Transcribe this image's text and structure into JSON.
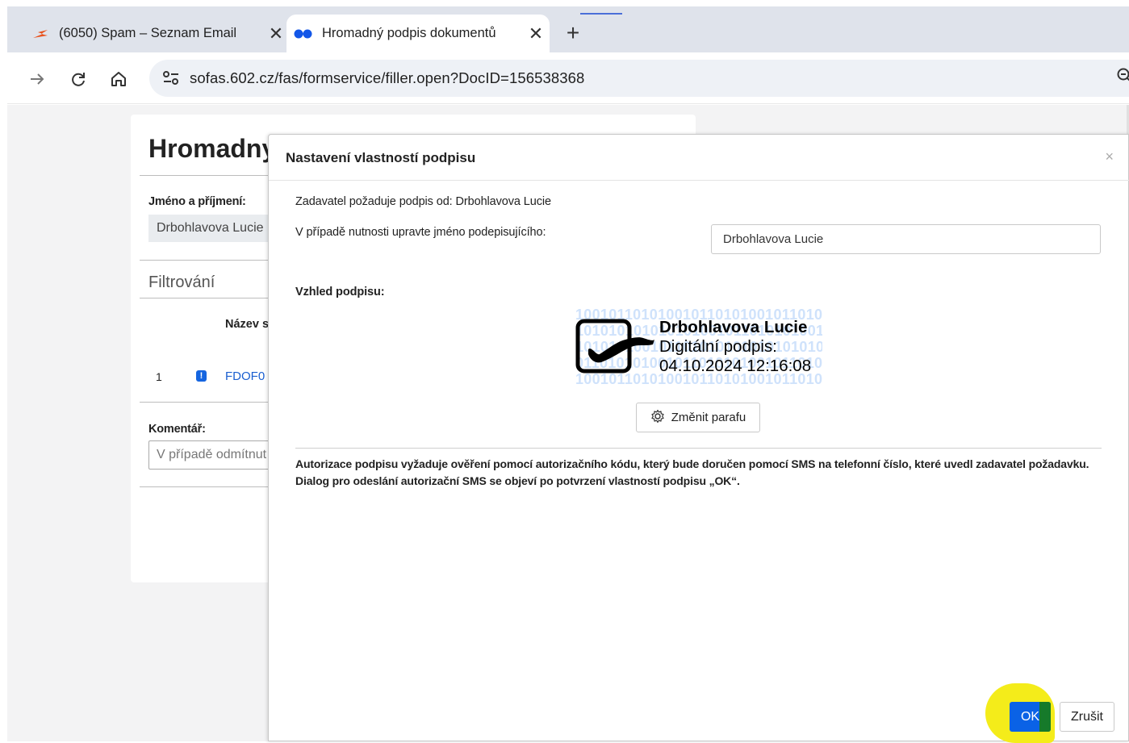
{
  "browser": {
    "tabs": [
      {
        "title": "(6050) Spam – Seznam Email",
        "close": "✕"
      },
      {
        "title": "Hromadný podpis dokumentů",
        "close": "✕"
      }
    ],
    "new_tab": "+",
    "url": "sofas.602.cz/fas/formservice/filler.open?DocID=156538368"
  },
  "page": {
    "title": "Hromadny",
    "name_label": "Jméno a příjmení:",
    "name_value": "Drbohlavova Lucie",
    "filter_title": "Filtrování",
    "column_header": "Název s",
    "row_number": "1",
    "row_icon": "!",
    "row_link": "FDOF0",
    "comment_label": "Komentář:",
    "comment_placeholder": "V případě odmítnut"
  },
  "dialog": {
    "title": "Nastavení vlastností podpisu",
    "close": "×",
    "requester_text": "Zadavatel požaduje podpis od: Drbohlavova Lucie",
    "edit_name_label": "V případě nutnosti upravte jméno podepisujícího:",
    "signer_name_value": "Drbohlavova Lucie",
    "appearance_label": "Vzhled podpisu:",
    "signature": {
      "binary_pattern": [
        "100101101010010110101001011010",
        "101010101010101001011010101001",
        "101010100101101010101010101010",
        "011010101001011010101001011010",
        "100101101010010110101001011010"
      ],
      "name": "Drbohlavova Lucie",
      "type": "Digitální podpis:",
      "date": "04.10.2024 12:16:08"
    },
    "change_initials_button": "Změnit parafu",
    "auth_notice": "Autorizace podpisu vyžaduje ověření pomocí autorizačního kódu, který bude doručen pomocí SMS na telefonní číslo, které uvedl zadavatel požadavku. Dialog pro odeslání autorizační SMS se objeví po potvrzení vlastností podpisu „OK“.",
    "ok_button": "OK",
    "cancel_button": "Zrušit"
  },
  "colors": {
    "accent": "#0a62e6",
    "highlight": "#f4ec1a",
    "link": "#1a5fd0"
  }
}
